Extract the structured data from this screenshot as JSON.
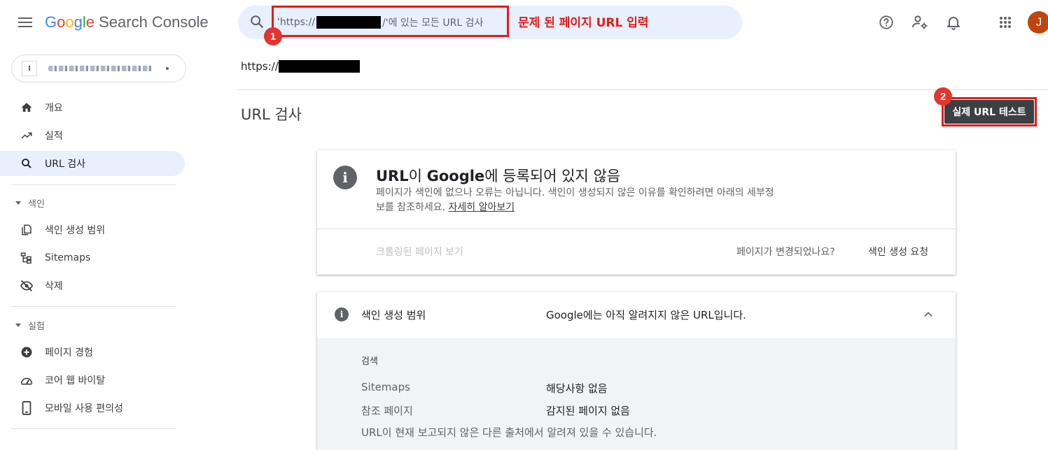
{
  "app": {
    "title": "Google Search Console",
    "logo_google": [
      "G",
      "o",
      "o",
      "g",
      "l",
      "e"
    ],
    "logo_suffix": " Search Console"
  },
  "search": {
    "placeholder_prefix": "'https://",
    "placeholder_suffix": "/'에 있는 모든 URL 검사"
  },
  "annotations": {
    "note_1": "문제 된 페이지 URL 입력",
    "marker_1": "1",
    "marker_2": "2",
    "color": "#e21b1b"
  },
  "topbar": {
    "icons": [
      "help-icon",
      "manage-users-icon",
      "notifications-icon",
      "apps-grid-icon"
    ],
    "avatar_letter": "J"
  },
  "sidebar": {
    "items": [
      {
        "label": "개요",
        "icon": "home-icon"
      },
      {
        "label": "실적",
        "icon": "trending-up-icon"
      },
      {
        "label": "URL 검사",
        "icon": "search-icon",
        "active": true
      }
    ],
    "sections": [
      {
        "title": "색인",
        "items": [
          {
            "label": "색인 생성 범위",
            "icon": "file-copy-icon"
          },
          {
            "label": "Sitemaps",
            "icon": "sitemap-icon"
          },
          {
            "label": "삭제",
            "icon": "visibility-off-icon"
          }
        ]
      },
      {
        "title": "실험",
        "items": [
          {
            "label": "페이지 경험",
            "icon": "add-circle-icon"
          },
          {
            "label": "코어 웹 바이탈",
            "icon": "speed-icon"
          },
          {
            "label": "모바일 사용 편의성",
            "icon": "smartphone-icon"
          }
        ]
      }
    ]
  },
  "main": {
    "url_prefix": "https://",
    "page_title": "URL 검사",
    "test_button": "실제 URL 테스트",
    "status": {
      "title_bold_1": "URL",
      "title_part_1": "이 ",
      "title_bold_2": "Google",
      "title_part_2": "에 등록되어 있지 않음",
      "desc": "페이지가 색인에 없으나 오류는 아닙니다. 색인이 생성되지 않은 이유를 확인하려면 아래의 세부정보를 참조하세요. ",
      "link": "자세히 알아보기",
      "crawled_link": "크롤링된 페이지 보기",
      "changed_question": "페이지가 변경되었나요?",
      "request_indexing": "색인 생성 요청"
    },
    "coverage": {
      "label": "색인 생성 범위",
      "status": "Google에는 아직 알려지지 않은 URL입니다.",
      "section": "검색",
      "rows": [
        {
          "label": "Sitemaps",
          "value": "해당사항 없음"
        },
        {
          "label": "참조 페이지",
          "value": "감지된 페이지 없음"
        }
      ],
      "note": "URL이 현재 보고되지 않은 다른 출처에서 알려져 있을 수 있습니다."
    }
  }
}
